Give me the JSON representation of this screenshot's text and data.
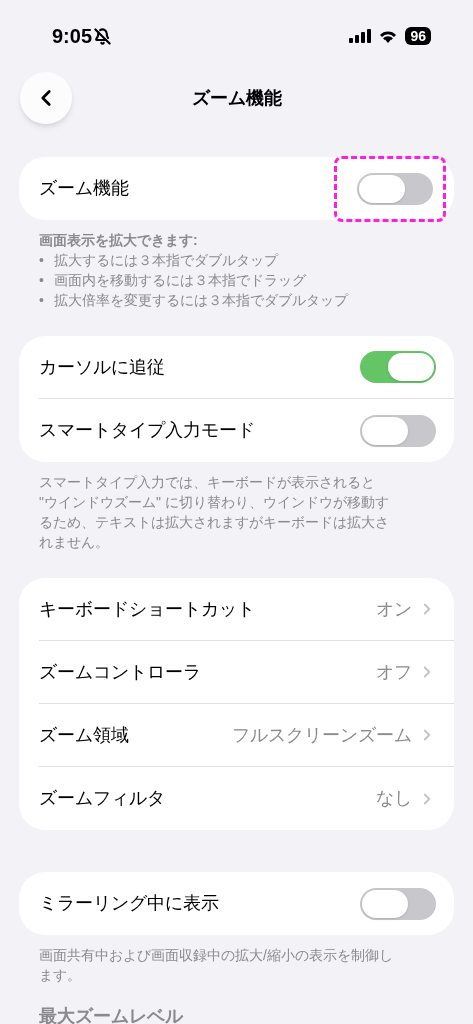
{
  "status_bar": {
    "time": "9:05",
    "muted": true,
    "battery": "96"
  },
  "nav": {
    "title": "ズーム機能"
  },
  "sections": [
    {
      "rows": [
        {
          "kind": "toggle",
          "label": "ズーム機能",
          "on": false,
          "highlighted": true
        }
      ],
      "footer": {
        "intro": "画面表示を拡大できます:",
        "bullet": "•",
        "items": [
          "拡大するには３本指でダブルタップ",
          "画面内を移動するには３本指でドラッグ",
          "拡大倍率を変更するには３本指でダブルタップ"
        ]
      }
    },
    {
      "rows": [
        {
          "kind": "toggle",
          "label": "カーソルに追従",
          "on": true,
          "highlighted": false
        },
        {
          "kind": "toggle",
          "label": "スマートタイプ入力モード",
          "on": false,
          "highlighted": false
        }
      ],
      "footer": {
        "text": "スマートタイプ入力では、キーボードが表示されると \"ウインドウズーム\" に切り替わり、ウインドウが移動するため、テキストは拡大されますがキーボードは拡大されません。"
      }
    },
    {
      "rows": [
        {
          "kind": "link",
          "label": "キーボードショートカット",
          "value": "オン"
        },
        {
          "kind": "link",
          "label": "ズームコントローラ",
          "value": "オフ"
        },
        {
          "kind": "link",
          "label": "ズーム領域",
          "value": "フルスクリーンズーム"
        },
        {
          "kind": "link",
          "label": "ズームフィルタ",
          "value": "なし"
        }
      ]
    },
    {
      "rows": [
        {
          "kind": "toggle",
          "label": "ミラーリング中に表示",
          "on": false,
          "highlighted": false
        }
      ],
      "footer": {
        "text": "画面共有中および画面収録中の拡大/縮小の表示を制御します。"
      }
    },
    {
      "header": "最大ズームレベル"
    }
  ]
}
